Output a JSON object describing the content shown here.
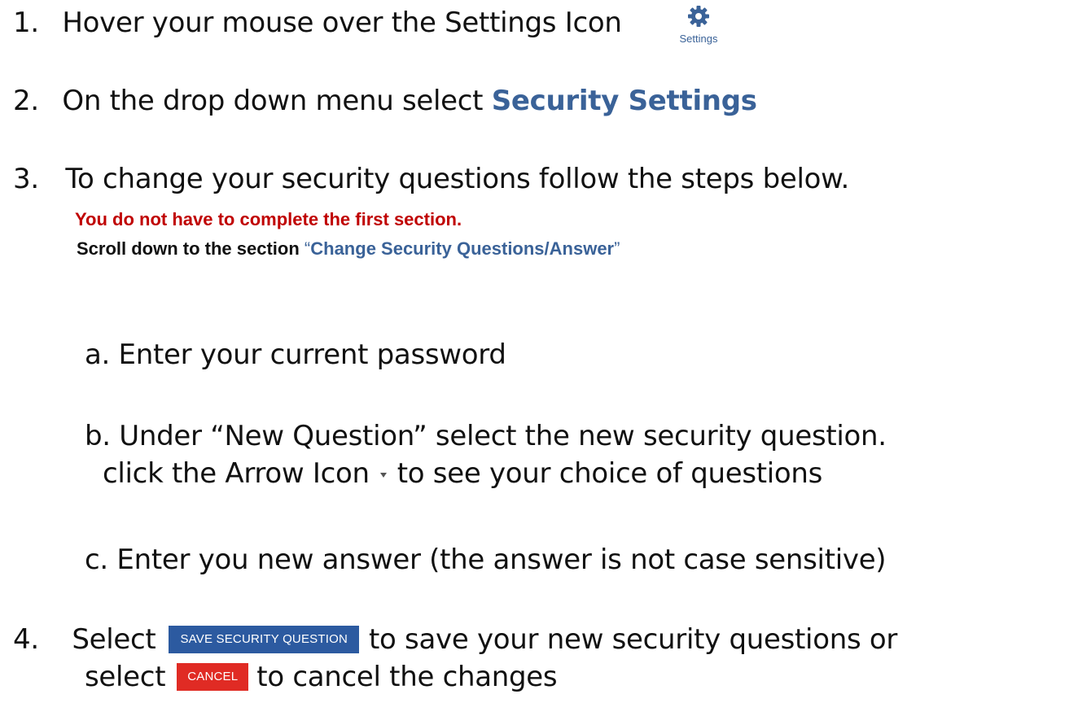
{
  "step1": {
    "number": "1.",
    "text": "Hover your mouse over the Settings Icon",
    "icon_caption": "Settings",
    "icon": "gear-icon"
  },
  "step2": {
    "number": "2.",
    "text": "On the drop down menu select",
    "highlight": "Security Settings"
  },
  "step3": {
    "number": "3.",
    "text": "To change your security questions follow the steps below.",
    "note_red": "You do not have to complete the first section.",
    "note_prefix": "Scroll down to the section",
    "note_open_quote": "“",
    "note_section": "Change Security Questions/Answer",
    "note_close_quote": "”",
    "sub_a": "a.  Enter your current password",
    "sub_b_line1": "b.  Under “New Question” select the new security question.",
    "sub_b_line2_pre": "click the Arrow Icon",
    "sub_b_line2_post": "to see your choice of questions",
    "sub_c": "c.  Enter you new answer (the answer is not case sensitive)"
  },
  "step4": {
    "number": "4.",
    "select_1": "Select",
    "save_button": "SAVE SECURITY QUESTION",
    "after_save": "to save your new security questions or",
    "select_2": "select",
    "cancel_button": "CANCEL",
    "after_cancel": "to cancel the changes"
  },
  "colors": {
    "accent_blue": "#3a6298",
    "warning_red": "#c00000",
    "save_button_bg": "#2c5aa0",
    "cancel_button_bg": "#e02b24"
  }
}
